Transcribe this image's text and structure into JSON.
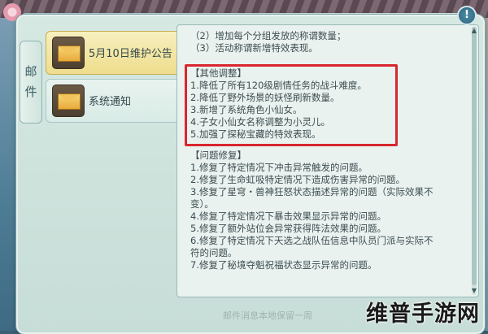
{
  "side_tab": {
    "char1": "邮",
    "char2": "件"
  },
  "mail_list": [
    {
      "label": "5月10日维护公告",
      "selected": true,
      "icon": "envelope-icon"
    },
    {
      "label": "系统通知",
      "selected": false,
      "icon": "envelope-icon"
    }
  ],
  "content_lines": [
    "（2）增加每个分组发放的称谓数量；",
    "（3）活动称谓新增特效表现。",
    "【其他调整】",
    "1.降低了所有120级剧情任务的战斗难度。",
    "2.降低了野外场景的妖怪刷新数量。",
    "3.新增了系统角色小仙女。",
    "4.子女小仙女名称调整为小灵儿。",
    "5.加强了探秘宝藏的特效表现。",
    "【问题修复】",
    "1.修复了特定情况下冲击异常触发的问题。",
    "2.修复了生命虹吸特定情况下造成伤害异常的问题。",
    "3.修复了星穹・兽神狂怒状态描述异常的问题（实际效果不",
    "变）。",
    "4.修复了特定情况下暴击效果显示异常的问题。",
    "5.修复了额外站位会异常获得阵法效果的问题。",
    "6.修复了特定情况下天选之战队伍信息中队员门派与实际不",
    "符的问题。",
    "7.修复了秘境夺魁祝福状态显示异常的问题。"
  ],
  "footer_note": "邮件消息本地保留一周",
  "watermark": "维普手游网",
  "info_button": "!",
  "colors": {
    "highlight_box": "#d9262e",
    "selected_item": "#eedd8c"
  }
}
